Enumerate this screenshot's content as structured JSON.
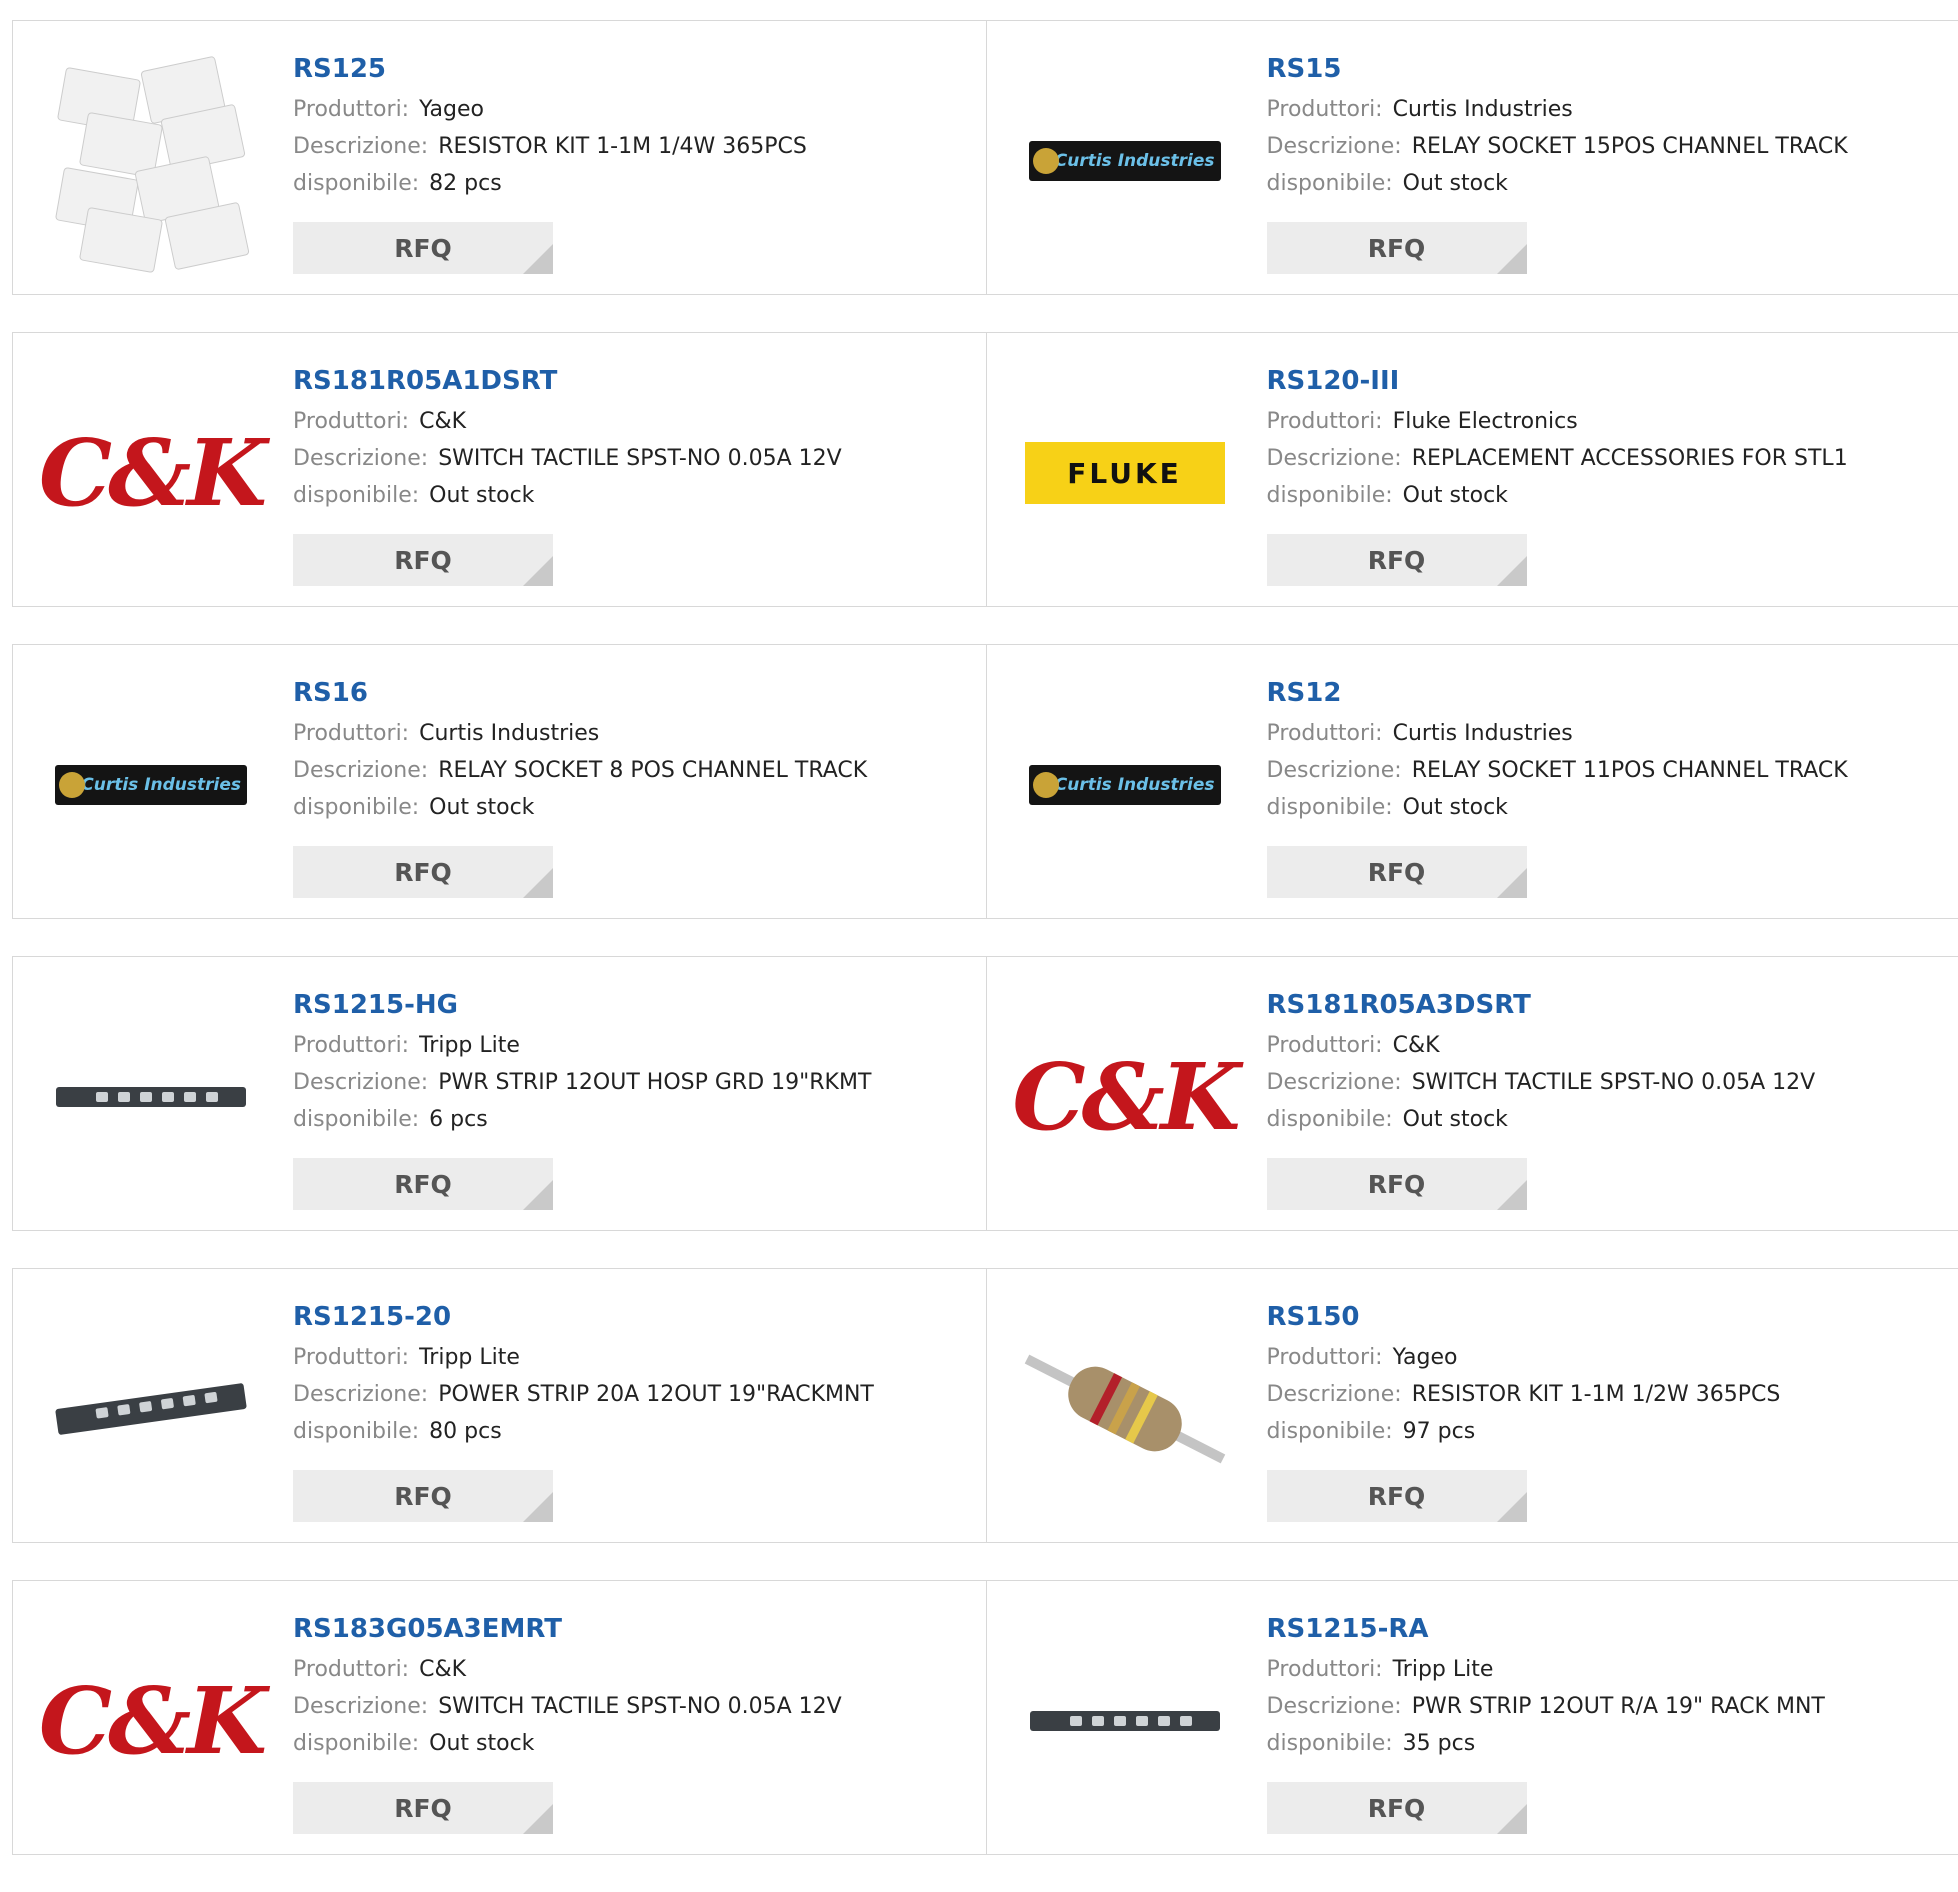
{
  "labels": {
    "manufacturer": "Produttori:",
    "description": "Descrizione:",
    "availability": "disponibile:",
    "rfq": "RFQ"
  },
  "products": [
    {
      "part": "RS125",
      "manufacturer": "Yageo",
      "description": "RESISTOR KIT 1-1M 1/4W 365PCS",
      "availability": "82 pcs",
      "image": "resistor-kit-bags"
    },
    {
      "part": "RS15",
      "manufacturer": "Curtis Industries",
      "description": "RELAY SOCKET 15POS CHANNEL TRACK",
      "availability": "Out stock",
      "image": "curtis-logo"
    },
    {
      "part": "RS181R05A1DSRT",
      "manufacturer": "C&K",
      "description": "SWITCH TACTILE SPST-NO 0.05A 12V",
      "availability": "Out stock",
      "image": "ck-logo"
    },
    {
      "part": "RS120-III",
      "manufacturer": "Fluke Electronics",
      "description": "REPLACEMENT ACCESSORIES FOR STL1",
      "availability": "Out stock",
      "image": "fluke-logo"
    },
    {
      "part": "RS16",
      "manufacturer": "Curtis Industries",
      "description": "RELAY SOCKET 8 POS CHANNEL TRACK",
      "availability": "Out stock",
      "image": "curtis-logo"
    },
    {
      "part": "RS12",
      "manufacturer": "Curtis Industries",
      "description": "RELAY SOCKET 11POS CHANNEL TRACK",
      "availability": "Out stock",
      "image": "curtis-logo"
    },
    {
      "part": "RS1215-HG",
      "manufacturer": "Tripp Lite",
      "description": "PWR STRIP 12OUT HOSP GRD 19\"RKMT",
      "availability": "6 pcs",
      "image": "power-strip"
    },
    {
      "part": "RS181R05A3DSRT",
      "manufacturer": "C&K",
      "description": "SWITCH TACTILE SPST-NO 0.05A 12V",
      "availability": "Out stock",
      "image": "ck-logo"
    },
    {
      "part": "RS1215-20",
      "manufacturer": "Tripp Lite",
      "description": "POWER STRIP 20A 12OUT 19\"RACKMNT",
      "availability": "80 pcs",
      "image": "power-strip-angled"
    },
    {
      "part": "RS150",
      "manufacturer": "Yageo",
      "description": "RESISTOR KIT 1-1M 1/2W 365PCS",
      "availability": "97 pcs",
      "image": "resistor"
    },
    {
      "part": "RS183G05A3EMRT",
      "manufacturer": "C&K",
      "description": "SWITCH TACTILE SPST-NO 0.05A 12V",
      "availability": "Out stock",
      "image": "ck-logo"
    },
    {
      "part": "RS1215-RA",
      "manufacturer": "Tripp Lite",
      "description": "PWR STRIP 12OUT R/A 19\" RACK MNT",
      "availability": "35 pcs",
      "image": "power-strip"
    }
  ],
  "logos": {
    "curtis": "Curtis Industries",
    "ck": "C&K",
    "fluke": "FLUKE"
  },
  "colors": {
    "part_link": "#1f5fa8",
    "label": "#888888",
    "rfq_bg": "#ececec",
    "border": "#d8d8d8"
  }
}
